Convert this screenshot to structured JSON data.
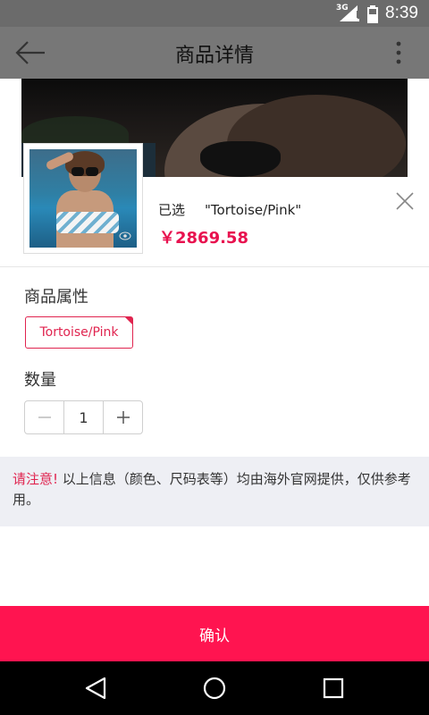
{
  "status_bar": {
    "network": "3G",
    "time": "8:39"
  },
  "header": {
    "title": "商品详情",
    "back_icon": "arrow-left-icon",
    "more_icon": "more-vertical-icon"
  },
  "product": {
    "selected_label": "已选",
    "selected_value": "\"Tortoise/Pink\"",
    "price": "￥2869.58"
  },
  "attributes": {
    "title": "商品属性",
    "options": [
      {
        "label": "Tortoise/Pink",
        "selected": true
      }
    ]
  },
  "quantity": {
    "title": "数量",
    "value": "1"
  },
  "notice": {
    "warning": "请注意!",
    "text": "以上信息（颜色、尺码表等）均由海外官网提供，仅供参考用。"
  },
  "confirm_label": "确认",
  "colors": {
    "accent": "#ff1450",
    "price": "#e8124f",
    "overlay": "#777777"
  }
}
